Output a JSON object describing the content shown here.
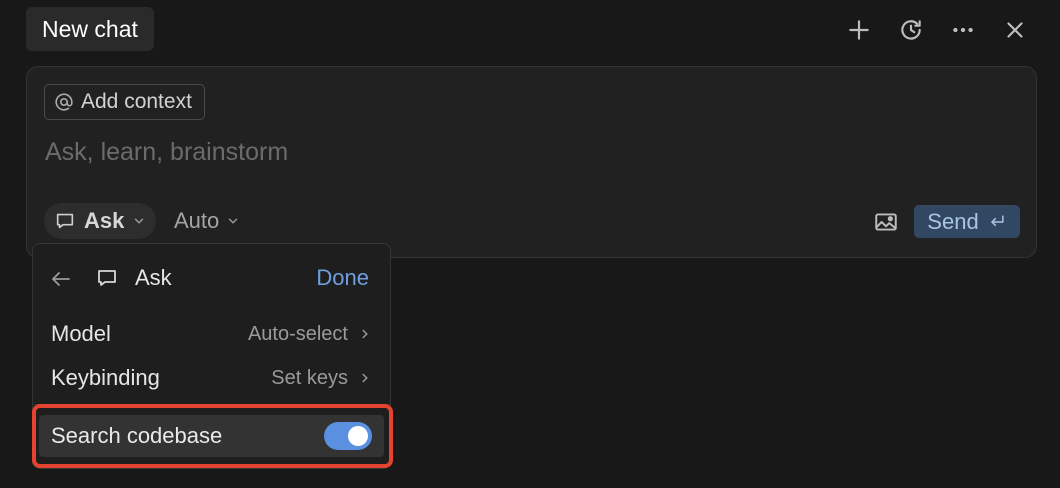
{
  "header": {
    "tab_title": "New chat",
    "actions": [
      {
        "icon": "plus-icon"
      },
      {
        "icon": "history-icon"
      },
      {
        "icon": "more-icon"
      },
      {
        "icon": "close-icon"
      }
    ]
  },
  "composer": {
    "add_context_label": "Add context",
    "input_placeholder": "Ask, learn, brainstorm",
    "input_value": "",
    "mode_label": "Ask",
    "model_label": "Auto",
    "send_label": "Send"
  },
  "mode_panel": {
    "title": "Ask",
    "done_label": "Done",
    "rows": [
      {
        "label": "Model",
        "value": "Auto-select"
      },
      {
        "label": "Keybinding",
        "value": "Set keys"
      }
    ],
    "search_codebase": {
      "label": "Search codebase",
      "enabled": true
    }
  },
  "colors": {
    "accent": "#5b8fe0",
    "send_bg": "#324862",
    "highlight": "#e4432f",
    "background": "#181818"
  }
}
